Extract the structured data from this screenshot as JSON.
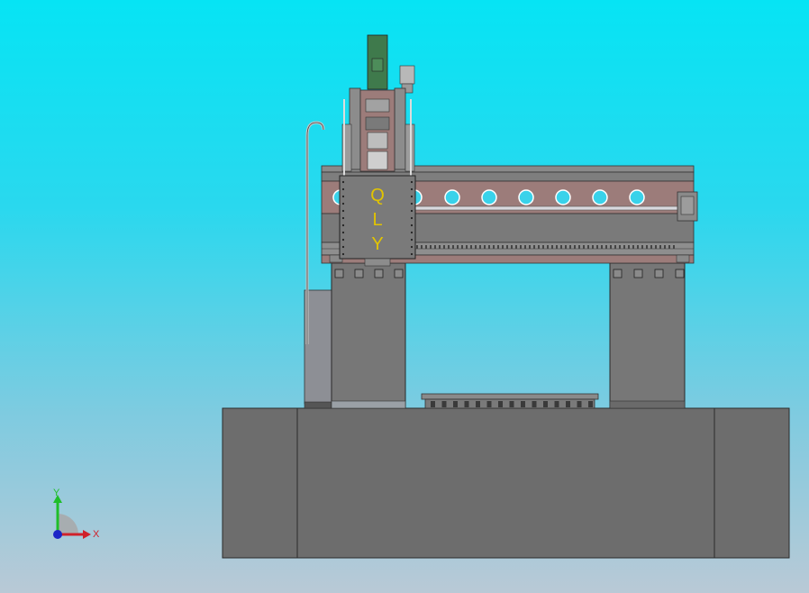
{
  "carriage": {
    "letters": [
      "Q",
      "L",
      "Y"
    ]
  },
  "triad": {
    "y_label": "Y",
    "x_label": "X",
    "colors": {
      "x": "#d0212a",
      "y": "#1fbe2a",
      "z": "#1c25c7"
    }
  },
  "colors": {
    "bed": "#6d6d6d",
    "structure": "#777777",
    "beam_band": "#9c7c7a",
    "letters": "#e2c400",
    "spindle": "#3f7a4c"
  }
}
